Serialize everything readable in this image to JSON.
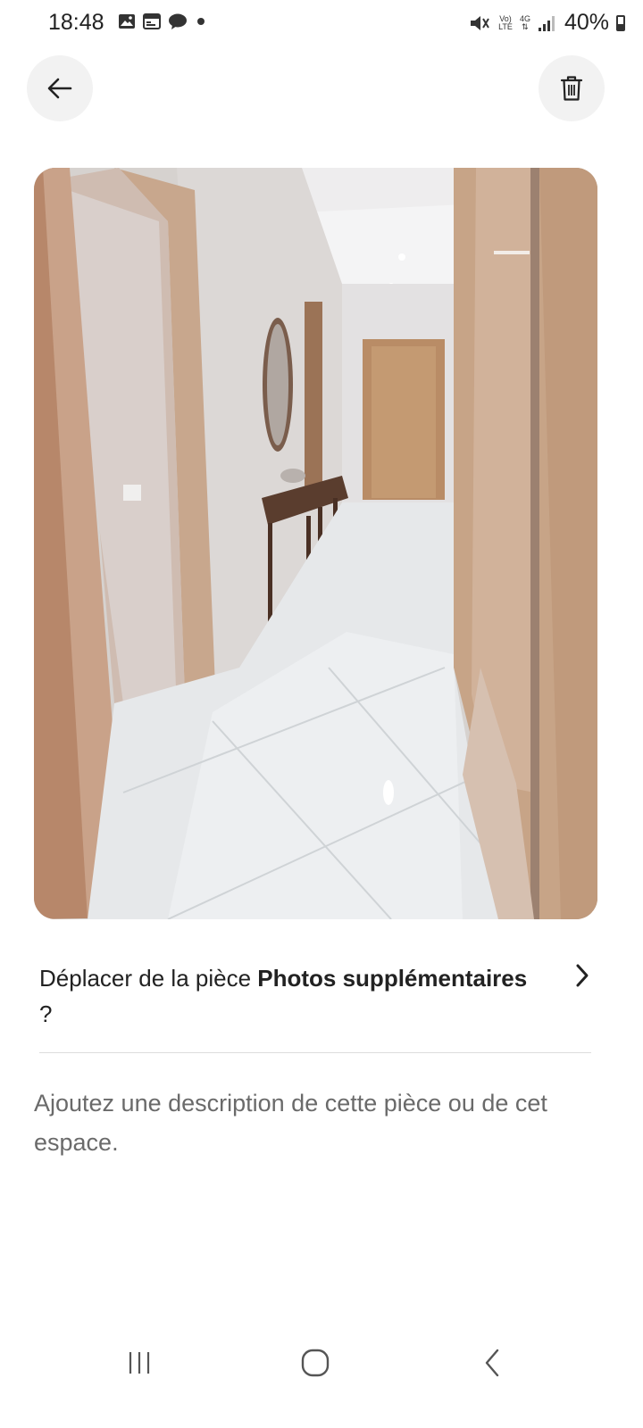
{
  "status_bar": {
    "time": "18:48",
    "network_top": "Vo)",
    "network_bottom": "LTE",
    "data_type": "4G",
    "battery": "40%"
  },
  "header": {
    "back_icon": "arrow-left-icon",
    "delete_icon": "trash-icon"
  },
  "photo": {
    "subject": "hallway with wooden doors, mirror, console table and white tile floor"
  },
  "move_row": {
    "prefix": "Déplacer de la pièce ",
    "room_name": "Photos supplémentaires",
    "suffix": " ?"
  },
  "description": {
    "placeholder": "Ajoutez une description de cette pièce ou de cet espace."
  },
  "nav_bar": {
    "recent_icon": "recent-apps-icon",
    "home_icon": "home-icon",
    "back_icon": "back-chevron-icon"
  }
}
